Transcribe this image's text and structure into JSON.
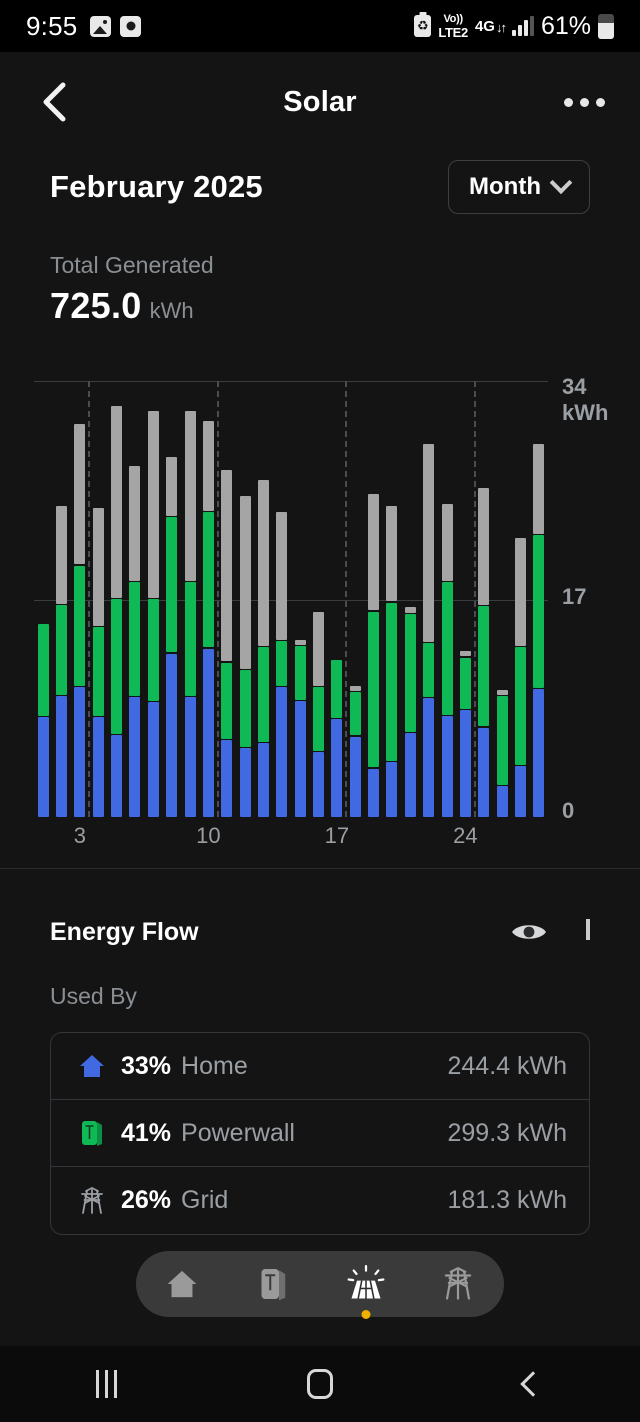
{
  "status_bar": {
    "clock": "9:55",
    "left_icons": [
      "photo-icon",
      "screen-recorder-icon"
    ],
    "carrier_alt": "Vo))",
    "carrier_lte": "LTE2",
    "network": "4G",
    "battery_percent": "61%",
    "right_icons": [
      "nfc-icon",
      "volte-icon",
      "data-arrows-icon",
      "signal-bars-icon",
      "battery-icon"
    ]
  },
  "nav": {
    "back_icon": "chevron-left-icon",
    "title": "Solar",
    "more_icon": "overflow-menu-icon"
  },
  "summary": {
    "period_title": "February 2025",
    "range_selector": {
      "label": "Month",
      "chevron": "chevron-down-icon"
    },
    "total_label": "Total Generated",
    "total_value": "725.0",
    "total_unit": "kWh"
  },
  "chart_data": {
    "type": "bar",
    "title": "Solar generation by day",
    "subtitle": "February 2025",
    "stacked": true,
    "xlabel": "",
    "ylabel": "kWh",
    "ylim": [
      0,
      34
    ],
    "yticks": [
      "0",
      "17",
      "34"
    ],
    "ytick_unit": "kWh",
    "grid": true,
    "gridlines_y": [
      0,
      17,
      34
    ],
    "legend_position": "none",
    "categories": [
      "1",
      "2",
      "3",
      "4",
      "5",
      "6",
      "7",
      "8",
      "9",
      "10",
      "11",
      "12",
      "13",
      "14",
      "15",
      "16",
      "17",
      "18",
      "19",
      "20",
      "21",
      "22",
      "23",
      "24",
      "25",
      "26",
      "27",
      "28"
    ],
    "xticks": [
      "3",
      "10",
      "17",
      "24"
    ],
    "xtick_indices": [
      2,
      9,
      16,
      23
    ],
    "series": [
      {
        "name": "Home",
        "color": "#4169e1",
        "values": [
          7.8,
          9.5,
          10.2,
          7.8,
          6.4,
          9.4,
          9.0,
          12.8,
          9.4,
          13.2,
          6.0,
          5.4,
          5.8,
          10.2,
          9.1,
          5.1,
          7.7,
          6.3,
          3.8,
          4.3,
          6.6,
          9.3,
          7.9,
          8.4,
          7.0,
          2.4,
          4.0,
          10.0
        ]
      },
      {
        "name": "Powerwall",
        "color": "#0fba56",
        "values": [
          7.2,
          7.0,
          9.4,
          7.0,
          10.6,
          8.9,
          8.0,
          10.6,
          8.9,
          10.6,
          6.0,
          6.0,
          7.4,
          3.5,
          4.2,
          5.0,
          4.5,
          3.4,
          12.2,
          12.4,
          9.2,
          4.2,
          10.4,
          4.0,
          9.4,
          7.0,
          9.2,
          12.0
        ]
      },
      {
        "name": "Grid",
        "color": "#a5a5a5",
        "values": [
          0.0,
          7.7,
          11.0,
          9.2,
          15.0,
          9.0,
          14.6,
          4.6,
          13.3,
          7.0,
          15.0,
          13.6,
          13.0,
          10.0,
          0.4,
          5.8,
          0.0,
          0.4,
          9.1,
          7.5,
          0.5,
          15.5,
          6.0,
          0.4,
          9.2,
          0.4,
          8.5,
          7.0
        ]
      }
    ],
    "totals": [
      15.0,
      24.2,
      30.6,
      24.0,
      32.0,
      27.3,
      31.6,
      28.0,
      31.6,
      30.8,
      27.0,
      25.0,
      26.2,
      23.7,
      13.7,
      15.9,
      12.2,
      10.1,
      25.1,
      24.2,
      16.3,
      29.0,
      24.3,
      12.8,
      25.6,
      9.8,
      21.7,
      29.0
    ]
  },
  "energy_flow": {
    "title": "Energy Flow",
    "visibility_icon": "eye-icon",
    "collapse_icon": "chevron-up-icon",
    "section_label": "Used By",
    "rows": [
      {
        "icon": "home-icon",
        "percent": "33%",
        "name": "Home",
        "value": "244.4 kWh",
        "color": "#4169e1"
      },
      {
        "icon": "powerwall-icon",
        "percent": "41%",
        "name": "Powerwall",
        "value": "299.3 kWh",
        "color": "#0fba56"
      },
      {
        "icon": "grid-tower-icon",
        "percent": "26%",
        "name": "Grid",
        "value": "181.3 kWh",
        "color": "#9a9fa4"
      }
    ]
  },
  "tab_bar": {
    "tabs": [
      {
        "icon": "home-icon",
        "name": "Home",
        "active": false
      },
      {
        "icon": "powerwall-icon",
        "name": "Powerwall",
        "active": false
      },
      {
        "icon": "solar-panel-icon",
        "name": "Solar",
        "active": true
      },
      {
        "icon": "grid-tower-icon",
        "name": "Grid",
        "active": false
      }
    ],
    "active_dot_color": "#f0b000"
  },
  "android_nav": {
    "recents_icon": "recents-icon",
    "home_icon": "home-square-icon",
    "back_icon": "back-chevron-icon"
  },
  "colors": {
    "background": "#141414",
    "home_blue": "#4169e1",
    "powerwall_green": "#0fba56",
    "grid_gray": "#a5a5a5",
    "muted_text": "#8a8f94"
  }
}
